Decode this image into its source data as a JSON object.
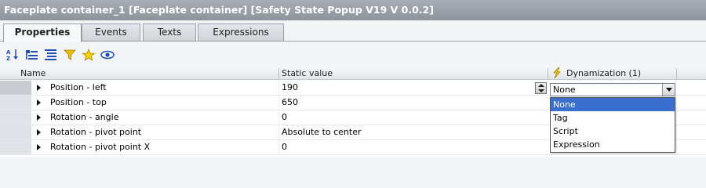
{
  "title": "Faceplate container_1 [Faceplate container] [Safety State Popup V19 V 0.0.2]",
  "tabs": [
    {
      "label": "Properties",
      "active": true
    },
    {
      "label": "Events",
      "active": false
    },
    {
      "label": "Texts",
      "active": false
    },
    {
      "label": "Expressions",
      "active": false
    }
  ],
  "toolbar": {
    "icons": [
      "sort-az-icon",
      "show-categories-icon",
      "show-all-icon",
      "filter-icon",
      "favorites-icon",
      "show-visible-icon"
    ]
  },
  "grid": {
    "columns": {
      "name": "Name",
      "static_value": "Static value",
      "dynamization": "Dynamization (1)"
    },
    "rows": [
      {
        "name": "Position - left",
        "value": "190"
      },
      {
        "name": "Position - top",
        "value": "650"
      },
      {
        "name": "Rotation - angle",
        "value": "0"
      },
      {
        "name": "Rotation - pivot point",
        "value": "Absolute to center"
      },
      {
        "name": "Rotation - pivot point X",
        "value": "0"
      }
    ]
  },
  "dynamization_combo": {
    "value": "None",
    "options": [
      "None",
      "Tag",
      "Script",
      "Expression"
    ],
    "selected": "None"
  },
  "colors": {
    "titlebar": "#9aa0a8",
    "selection": "#3a6fd0",
    "dynamization_icon": "#f0c000"
  }
}
